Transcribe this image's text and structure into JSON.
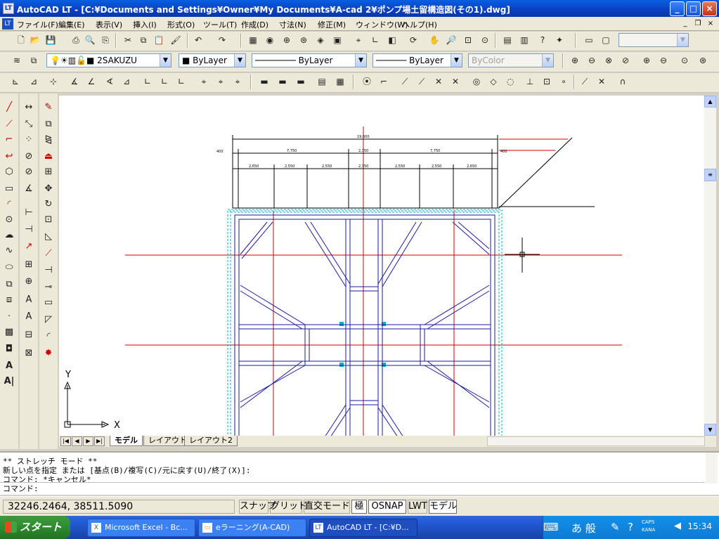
{
  "window": {
    "title": "AutoCAD LT - [C:¥Documents and Settings¥Owner¥My Documents¥A-cad 2¥ポンプ場土留構造図(その1).dwg]"
  },
  "menu": {
    "items": [
      "ファイル(F)",
      "編集(E)",
      "表示(V)",
      "挿入(I)",
      "形式(O)",
      "ツール(T)",
      "作成(D)",
      "寸法(N)",
      "修正(M)",
      "ウィンドウ(W)",
      "ヘルプ(H)"
    ]
  },
  "layers_toolbar": {
    "layer_name": "2SAKUZU",
    "color": "ByLayer",
    "linetype": "ByLayer",
    "lineweight": "ByLayer",
    "plotstyle": "ByColor"
  },
  "drawing": {
    "dims_top": "19,600",
    "dims_mid": [
      "400",
      "7,750",
      "2,350",
      "7,750",
      "400"
    ],
    "dims_bottom": [
      "2,650",
      "2,550",
      "2,550",
      "2,350",
      "2,550",
      "2,550",
      "2,650"
    ],
    "axis_x": "X",
    "axis_y": "Y"
  },
  "layout_tabs": [
    "モデル",
    "レイアウト1",
    "レイアウト2"
  ],
  "command": {
    "lines": [
      "** ストレッチ モード **",
      "新しい点を指定 または [基点(B)/複写(C)/元に戻す(U)/終了(X)]:",
      "コマンド: *キャンセル*"
    ],
    "prompt": "コマンド:"
  },
  "status": {
    "coords": "32246.2464, 38511.5090",
    "buttons": [
      "スナップ",
      "グリッド",
      "直交モード",
      "極",
      "OSNAP",
      "LWT",
      "モデル"
    ]
  },
  "taskbar": {
    "start": "スタート",
    "tasks": [
      "Microsoft Excel - Bc...",
      "eラーニング(A-CAD)",
      "AutoCAD LT - [C:¥D..."
    ],
    "clock": "15:34",
    "ime_chars": "あ 般",
    "caps": "CAPS",
    "kana": "KANA"
  }
}
